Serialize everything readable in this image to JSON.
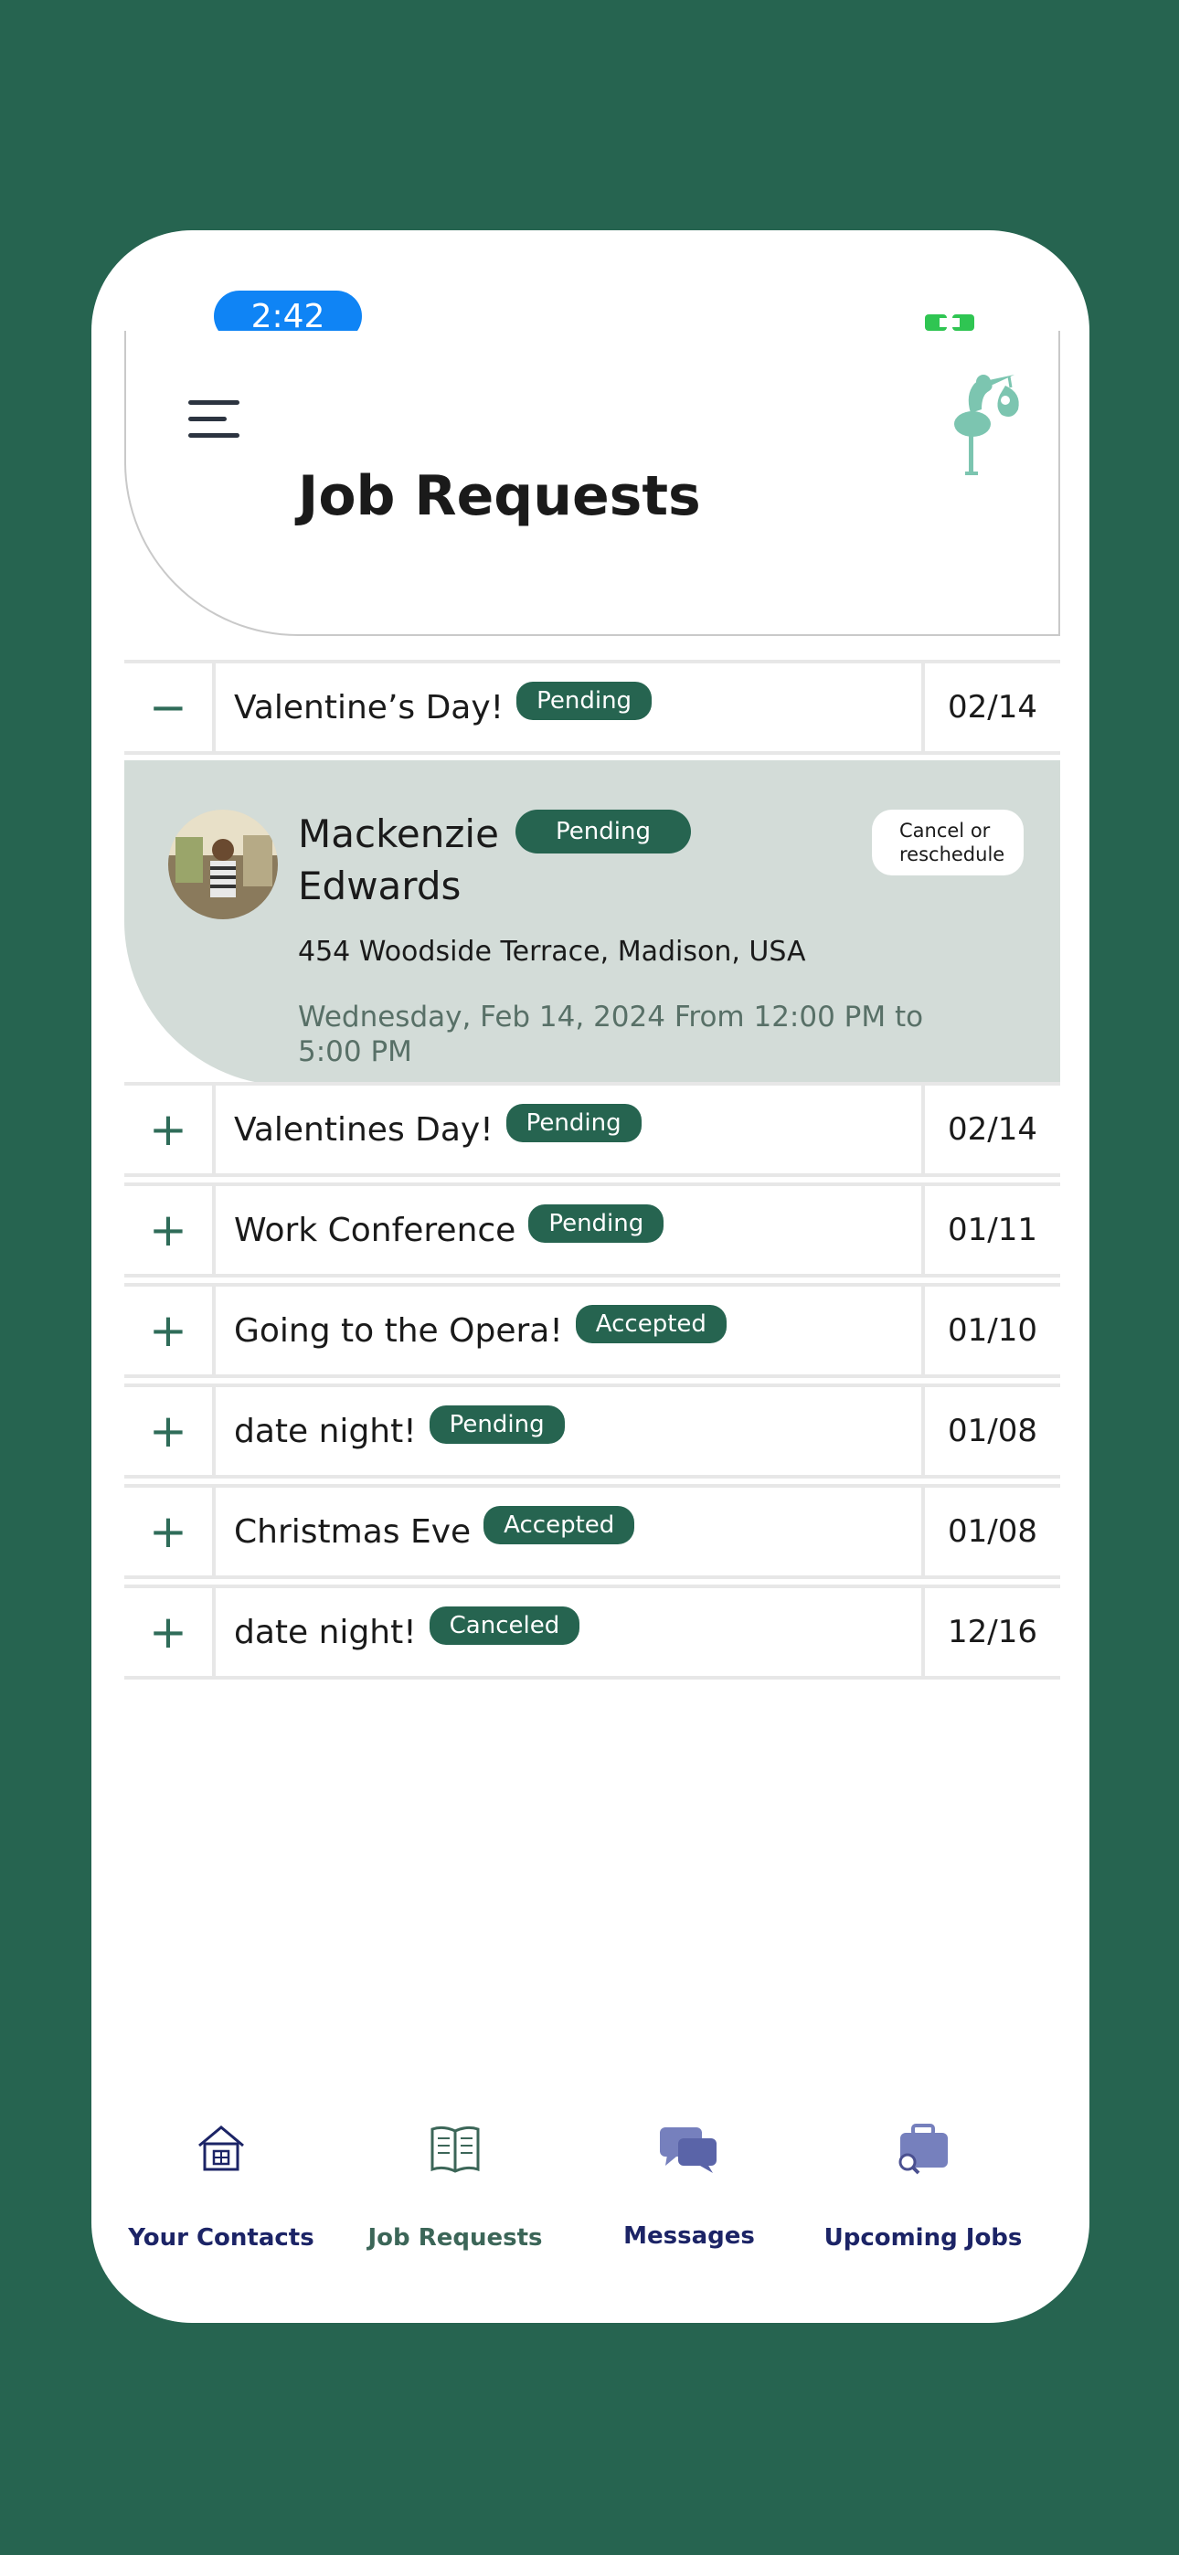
{
  "status_bar": {
    "time": "2:42"
  },
  "header": {
    "title": "Job Requests"
  },
  "colors": {
    "brand_green": "#266450",
    "status_blue": "#0f84f5",
    "logo_mint": "#7cc5b0",
    "nav_indigo": "#1c2466"
  },
  "expanded_request": {
    "title": "Valentine’s Day!",
    "status": "Pending",
    "date": "02/14",
    "toggle": "−",
    "client_name": "Mackenzie Edwards",
    "client_status": "Pending",
    "cancel_button": "Cancel or reschedule",
    "address": "454 Woodside Terrace, Madison, USA",
    "datetime": "Wednesday, Feb 14, 2024 From 12:00 PM to 5:00 PM"
  },
  "requests": [
    {
      "toggle": "+",
      "title": "Valentines Day!",
      "status": "Pending",
      "date": "02/14"
    },
    {
      "toggle": "+",
      "title": "Work Conference",
      "status": "Pending",
      "date": "01/11"
    },
    {
      "toggle": "+",
      "title": "Going to the Opera!",
      "status": "Accepted",
      "date": "01/10"
    },
    {
      "toggle": "+",
      "title": "date night!",
      "status": "Pending",
      "date": "01/08"
    },
    {
      "toggle": "+",
      "title": "Christmas Eve",
      "status": "Accepted",
      "date": "01/08"
    },
    {
      "toggle": "+",
      "title": "date night!",
      "status": "Canceled",
      "date": "12/16"
    }
  ],
  "nav": [
    {
      "label": "Your Contacts",
      "icon": "home-icon",
      "color": "#1c2466"
    },
    {
      "label": "Job Requests",
      "icon": "book-icon",
      "color": "#3c6658"
    },
    {
      "label": "Messages",
      "icon": "chat-icon",
      "color": "#1c2466"
    },
    {
      "label": "Upcoming Jobs",
      "icon": "briefcase-icon",
      "color": "#1c2466"
    }
  ]
}
